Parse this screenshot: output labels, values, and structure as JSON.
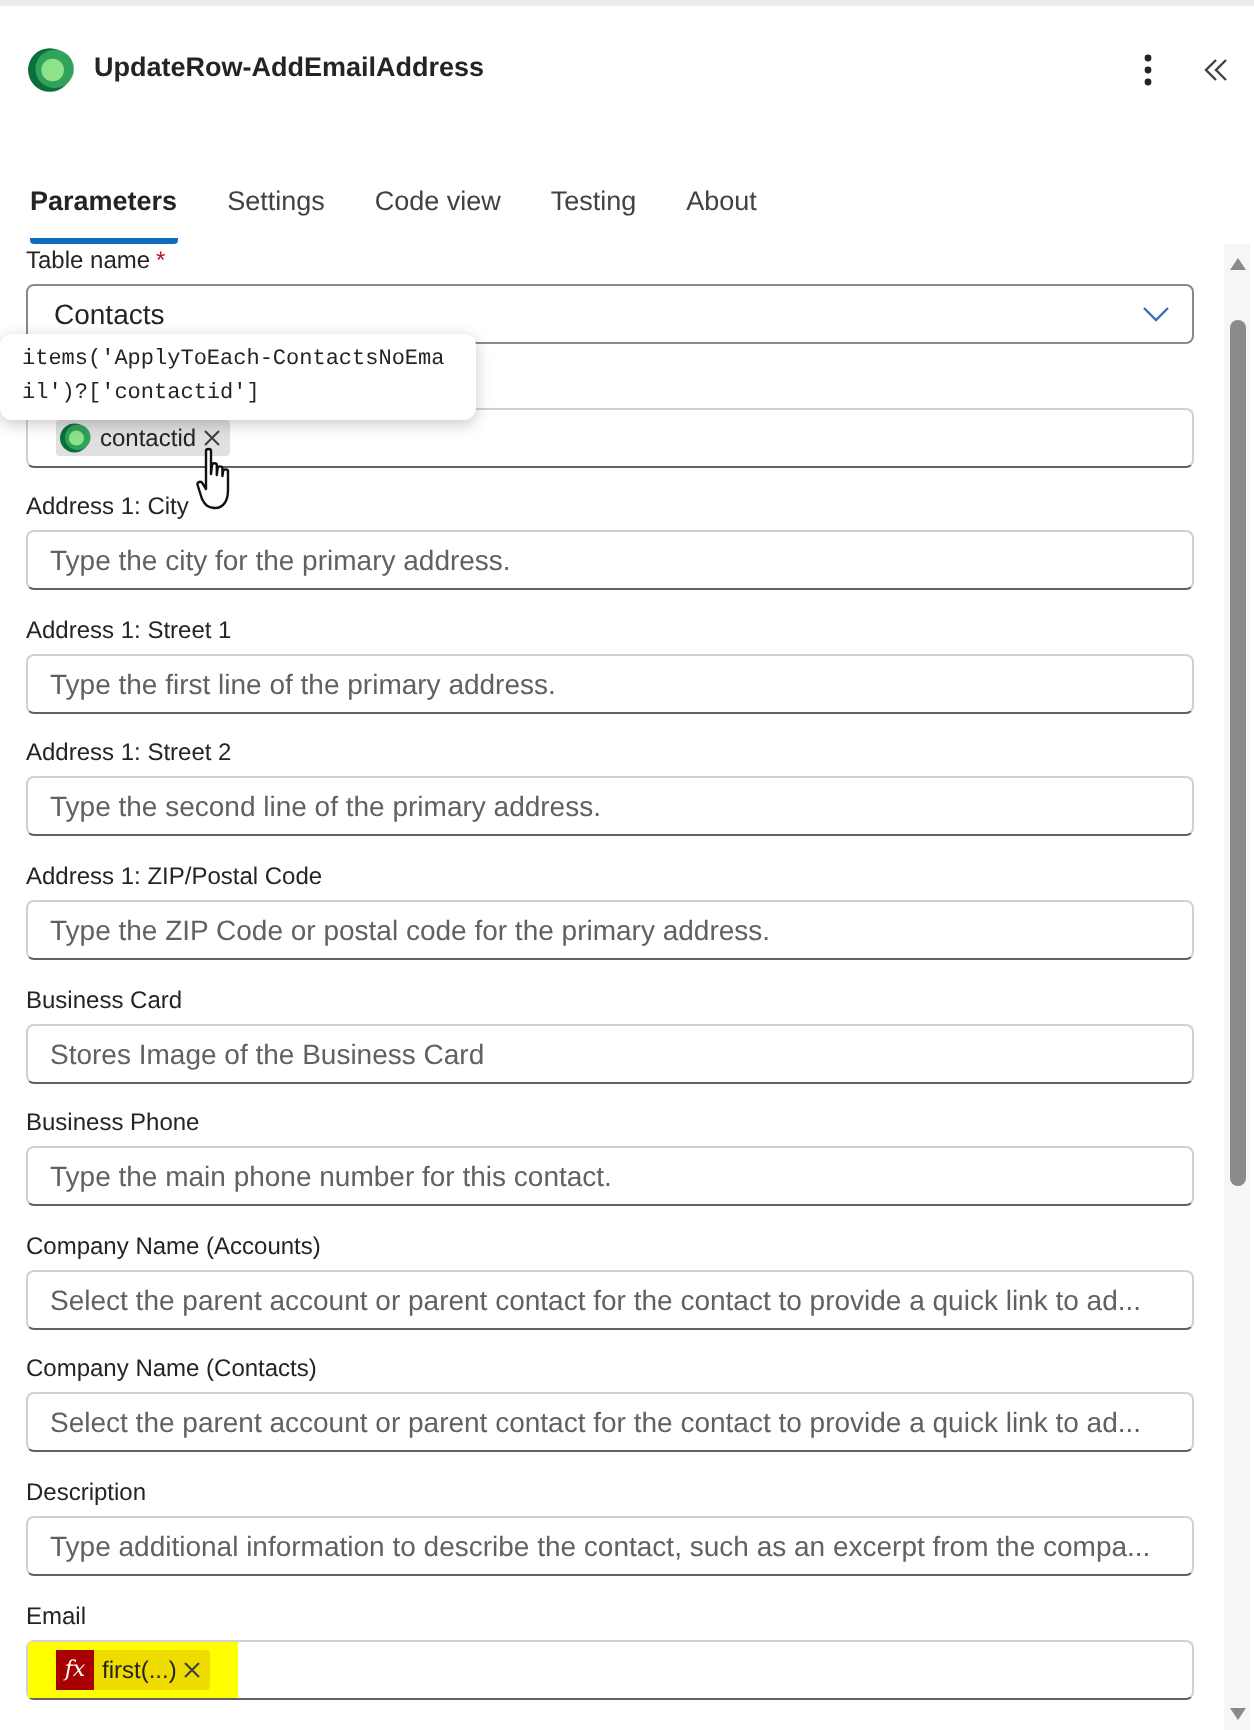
{
  "header": {
    "title": "UpdateRow-AddEmailAddress"
  },
  "tabs": [
    {
      "label": "Parameters",
      "selected": true
    },
    {
      "label": "Settings",
      "selected": false
    },
    {
      "label": "Code view",
      "selected": false
    },
    {
      "label": "Testing",
      "selected": false
    },
    {
      "label": "About",
      "selected": false
    }
  ],
  "fields": [
    {
      "kind": "dropdown",
      "label": "Table name",
      "required_mark": "*",
      "value": "Contacts"
    },
    {
      "kind": "token",
      "tokens": [
        {
          "kind": "dataverse",
          "text": "contactid",
          "highlighted": false
        }
      ],
      "tooltip": {
        "lines": [
          "items('ApplyToEach-ContactsNoEma",
          "il')?['contactid']"
        ]
      }
    },
    {
      "kind": "text",
      "label": "Address 1: City",
      "placeholder": "Type the city for the primary address."
    },
    {
      "kind": "text",
      "label": "Address 1: Street 1",
      "placeholder": "Type the first line of the primary address."
    },
    {
      "kind": "text",
      "label": "Address 1: Street 2",
      "placeholder": "Type the second line of the primary address."
    },
    {
      "kind": "text",
      "label": "Address 1: ZIP/Postal Code",
      "placeholder": "Type the ZIP Code or postal code for the primary address."
    },
    {
      "kind": "text",
      "label": "Business Card",
      "placeholder": "Stores Image of the Business Card"
    },
    {
      "kind": "text",
      "label": "Business Phone",
      "placeholder": "Type the main phone number for this contact."
    },
    {
      "kind": "text",
      "label": "Company Name (Accounts)",
      "placeholder": "Select the parent account or parent contact for the contact to provide a quick link to ad..."
    },
    {
      "kind": "text",
      "label": "Company Name (Contacts)",
      "placeholder": "Select the parent account or parent contact for the contact to provide a quick link to ad..."
    },
    {
      "kind": "text",
      "label": "Description",
      "placeholder": "Type additional information to describe the contact, such as an excerpt from the compa..."
    },
    {
      "kind": "token",
      "label": "Email",
      "tokens": [
        {
          "kind": "expression",
          "badge": "fx",
          "text": "first(...)",
          "highlighted": true
        }
      ]
    }
  ]
}
